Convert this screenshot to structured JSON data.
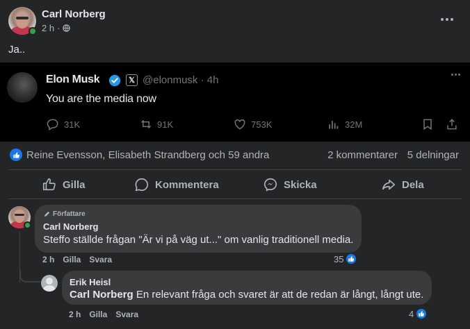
{
  "post": {
    "author": "Carl Norberg",
    "time": "2 h",
    "separator": "·",
    "text": "Ja.."
  },
  "tweet": {
    "name": "Elon Musk",
    "x_badge": "𝕏",
    "handle": "@elonmusk · 4h",
    "text": "You are the media now",
    "stats": {
      "replies": "31K",
      "reposts": "91K",
      "likes": "753K",
      "views": "32M"
    }
  },
  "reactions": {
    "names": "Reine Evensson, Elisabeth Strandberg och 59 andra",
    "comments": "2 kommentarer",
    "shares": "5 delningar"
  },
  "actions": {
    "like": "Gilla",
    "comment": "Kommentera",
    "send": "Skicka",
    "share": "Dela"
  },
  "comments": [
    {
      "author_tag": "Författare",
      "author": "Carl Norberg",
      "text": "Steffo ställde frågan \"Är vi på väg ut...\" om vanlig traditionell media.",
      "time": "2 h",
      "like": "Gilla",
      "reply": "Svara",
      "likes": "35"
    },
    {
      "author": "Erik Heisl",
      "mention": "Carl Norberg",
      "text": " En relevant fråga och svaret är att de redan är långt, långt ute.",
      "time": "2 h",
      "like": "Gilla",
      "reply": "Svara",
      "likes": "4"
    }
  ],
  "colors": {
    "background": "#242526",
    "bubble": "#3a3b3c",
    "accent": "#1877f2",
    "online": "#31a24c",
    "secondary_text": "#b0b3b8"
  }
}
